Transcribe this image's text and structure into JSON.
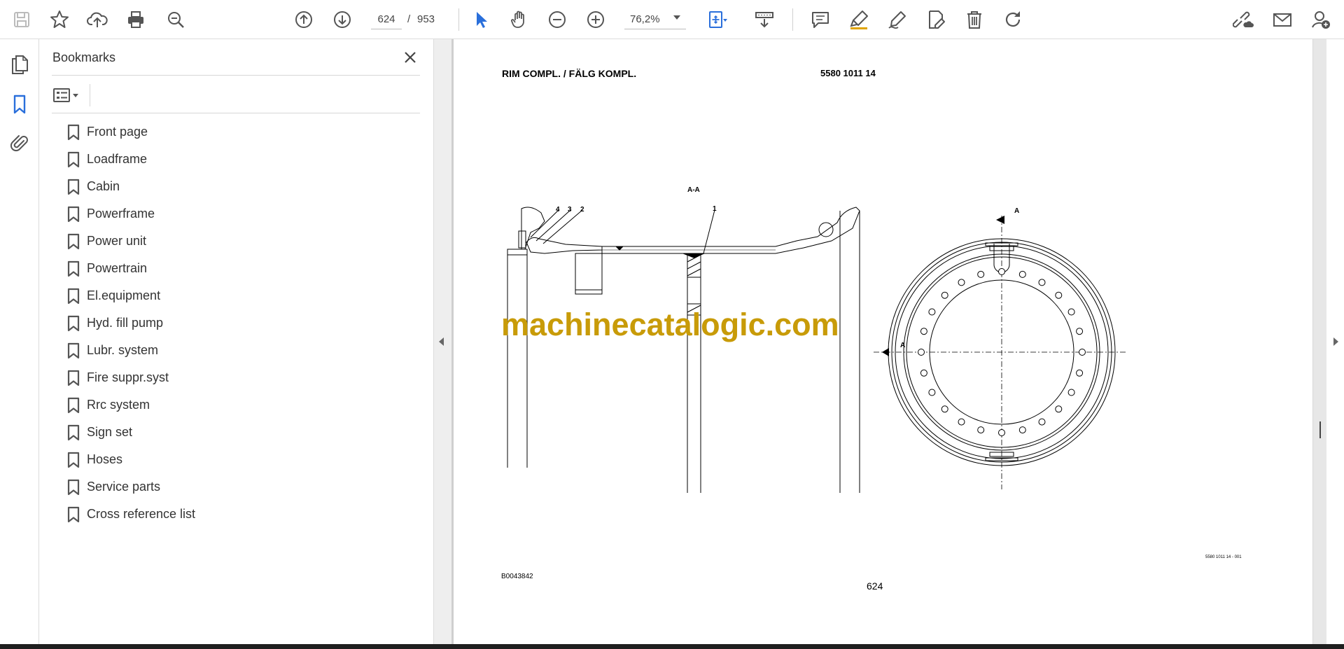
{
  "toolbar": {
    "page_current": "624",
    "page_separator": "/",
    "page_total": "953",
    "zoom": "76,2%"
  },
  "bookmarks_panel": {
    "title": "Bookmarks",
    "items": [
      {
        "label": "Front page"
      },
      {
        "label": "Loadframe"
      },
      {
        "label": "Cabin"
      },
      {
        "label": "Powerframe"
      },
      {
        "label": "Power unit"
      },
      {
        "label": "Powertrain"
      },
      {
        "label": "El.equipment"
      },
      {
        "label": "Hyd. fill pump"
      },
      {
        "label": "Lubr. system"
      },
      {
        "label": "Fire suppr.syst"
      },
      {
        "label": "Rrc system"
      },
      {
        "label": "Sign set"
      },
      {
        "label": "Hoses"
      },
      {
        "label": "Service parts"
      },
      {
        "label": "Cross reference list"
      }
    ]
  },
  "document": {
    "title": "RIM COMPL. / FÄLG KOMPL.",
    "part_number": "5580 1011 14",
    "section_label": "A-A",
    "callouts": [
      "4",
      "3",
      "2",
      "1"
    ],
    "section_marker": "A",
    "drawing_code": "B0043842",
    "page_number": "624",
    "drawing_ref": "5580 1011 14 - 001",
    "watermark": "machinecatalogic.com"
  },
  "colors": {
    "accent_blue": "#2a6fdb",
    "watermark_gold": "#c89b08"
  }
}
